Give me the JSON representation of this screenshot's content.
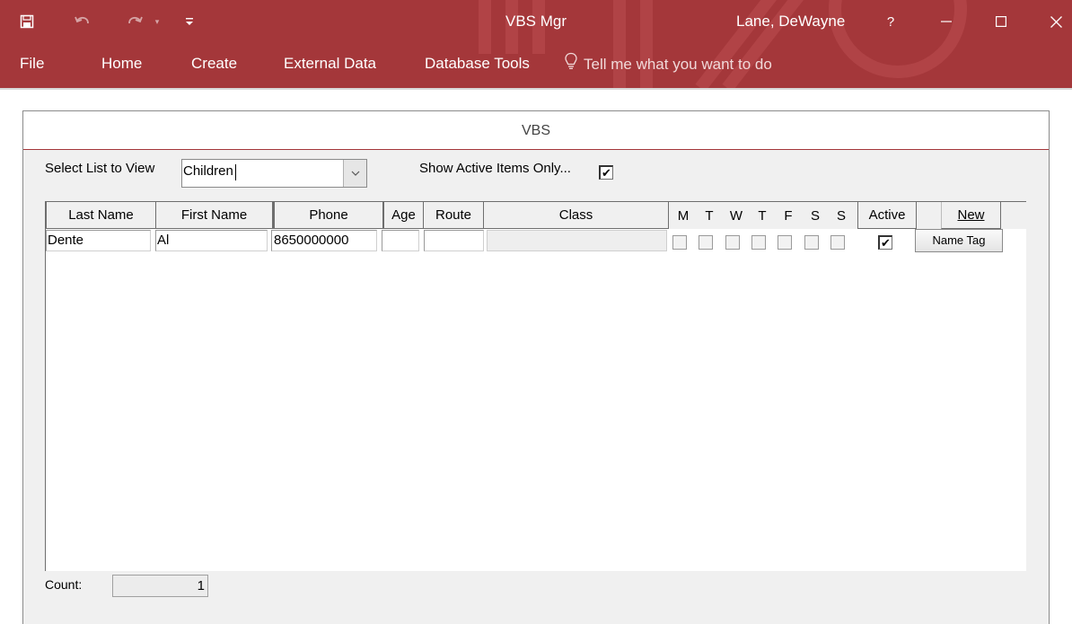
{
  "titlebar": {
    "app_title": "VBS Mgr",
    "user": "Lane, DeWayne",
    "help": "?",
    "brand_color": "#a4373a"
  },
  "quick_access": {
    "icons": [
      "save-icon",
      "undo-icon",
      "redo-icon",
      "customize-icon"
    ]
  },
  "window_controls": [
    "minimize-icon",
    "restore-icon",
    "close-icon"
  ],
  "menu": {
    "items": [
      "File",
      "Home",
      "Create",
      "External Data",
      "Database Tools"
    ],
    "tell_me": "Tell me what you want to do"
  },
  "form": {
    "title": "VBS",
    "select_label": "Select List to View",
    "select_value": "Children",
    "active_only_label": "Show Active Items Only...",
    "active_only_checked": true,
    "columns": {
      "last_name": "Last Name",
      "first_name": "First Name",
      "phone": "Phone",
      "age": "Age",
      "route": "Route",
      "class": "Class",
      "days": [
        "M",
        "T",
        "W",
        "T",
        "F",
        "S",
        "S"
      ],
      "active": "Active",
      "new": "New"
    },
    "rows": [
      {
        "last_name": "Dente",
        "first_name": "Al",
        "phone": "8650000000",
        "age": "",
        "route": "",
        "class": "",
        "days": [
          false,
          false,
          false,
          false,
          false,
          false,
          false
        ],
        "active": true,
        "button": "Name Tag"
      }
    ],
    "count_label": "Count:",
    "count_value": "1"
  }
}
